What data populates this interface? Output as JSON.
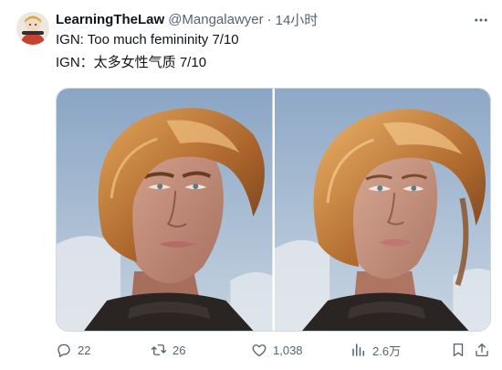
{
  "author": {
    "display_name": "LearningTheLaw",
    "handle": "@Mangalawyer",
    "separator": "·",
    "time": "14小时"
  },
  "tweet": {
    "line1": "IGN: Too much femininity 7/10",
    "line2": "IGN：太多女性气质 7/10"
  },
  "media": [
    {
      "icon": "portrait-photo",
      "alt": ""
    },
    {
      "icon": "portrait-photo",
      "alt": ""
    }
  ],
  "actions": {
    "reply": {
      "icon": "reply-icon",
      "count": "22"
    },
    "retweet": {
      "icon": "retweet-icon",
      "count": "26"
    },
    "like": {
      "icon": "heart-icon",
      "count": "1,038"
    },
    "views": {
      "icon": "views-icon",
      "count": "2.6万"
    },
    "bookmark": {
      "icon": "bookmark-icon"
    },
    "share": {
      "icon": "share-icon"
    }
  },
  "colors": {
    "text_primary": "#0f1419",
    "text_secondary": "#536471",
    "border": "#cfd9de",
    "hair": "#b9702f",
    "skin": "#c08b78",
    "sky": "#a9bfd6",
    "collar": "#2a2522"
  }
}
